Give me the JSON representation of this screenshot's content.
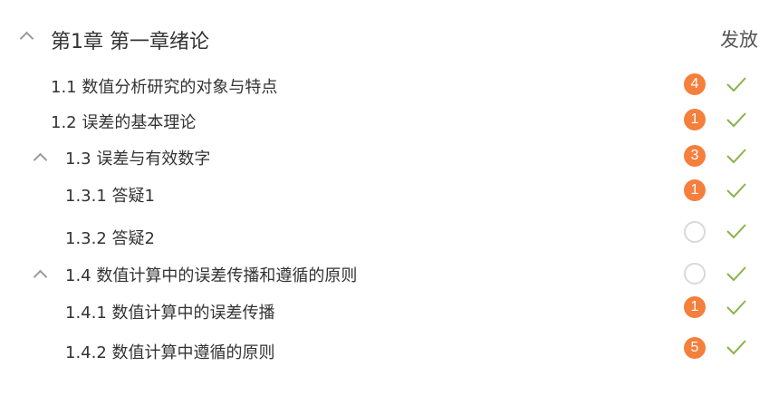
{
  "chapter": {
    "title": "第1章 第一章绪论",
    "publish_label": "发放"
  },
  "items": [
    {
      "label": "1.1  数值分析研究的对象与特点",
      "badge": "4"
    },
    {
      "label": "1.2  误差的基本理论",
      "badge": "1"
    },
    {
      "label": "1.3  误差与有效数字",
      "badge": "3"
    },
    {
      "label": "1.3.1 答疑1",
      "badge": "1"
    },
    {
      "label": "1.3.2 答疑2",
      "badge": ""
    },
    {
      "label": "1.4  数值计算中的误差传播和遵循的原则",
      "badge": ""
    },
    {
      "label": "1.4.1 数值计算中的误差传播",
      "badge": "1"
    },
    {
      "label": "1.4.2 数值计算中遵循的原则",
      "badge": "5"
    }
  ],
  "colors": {
    "badge": "#f57f3c",
    "check": "#8bb34a",
    "chevron": "#9a9a9a"
  }
}
